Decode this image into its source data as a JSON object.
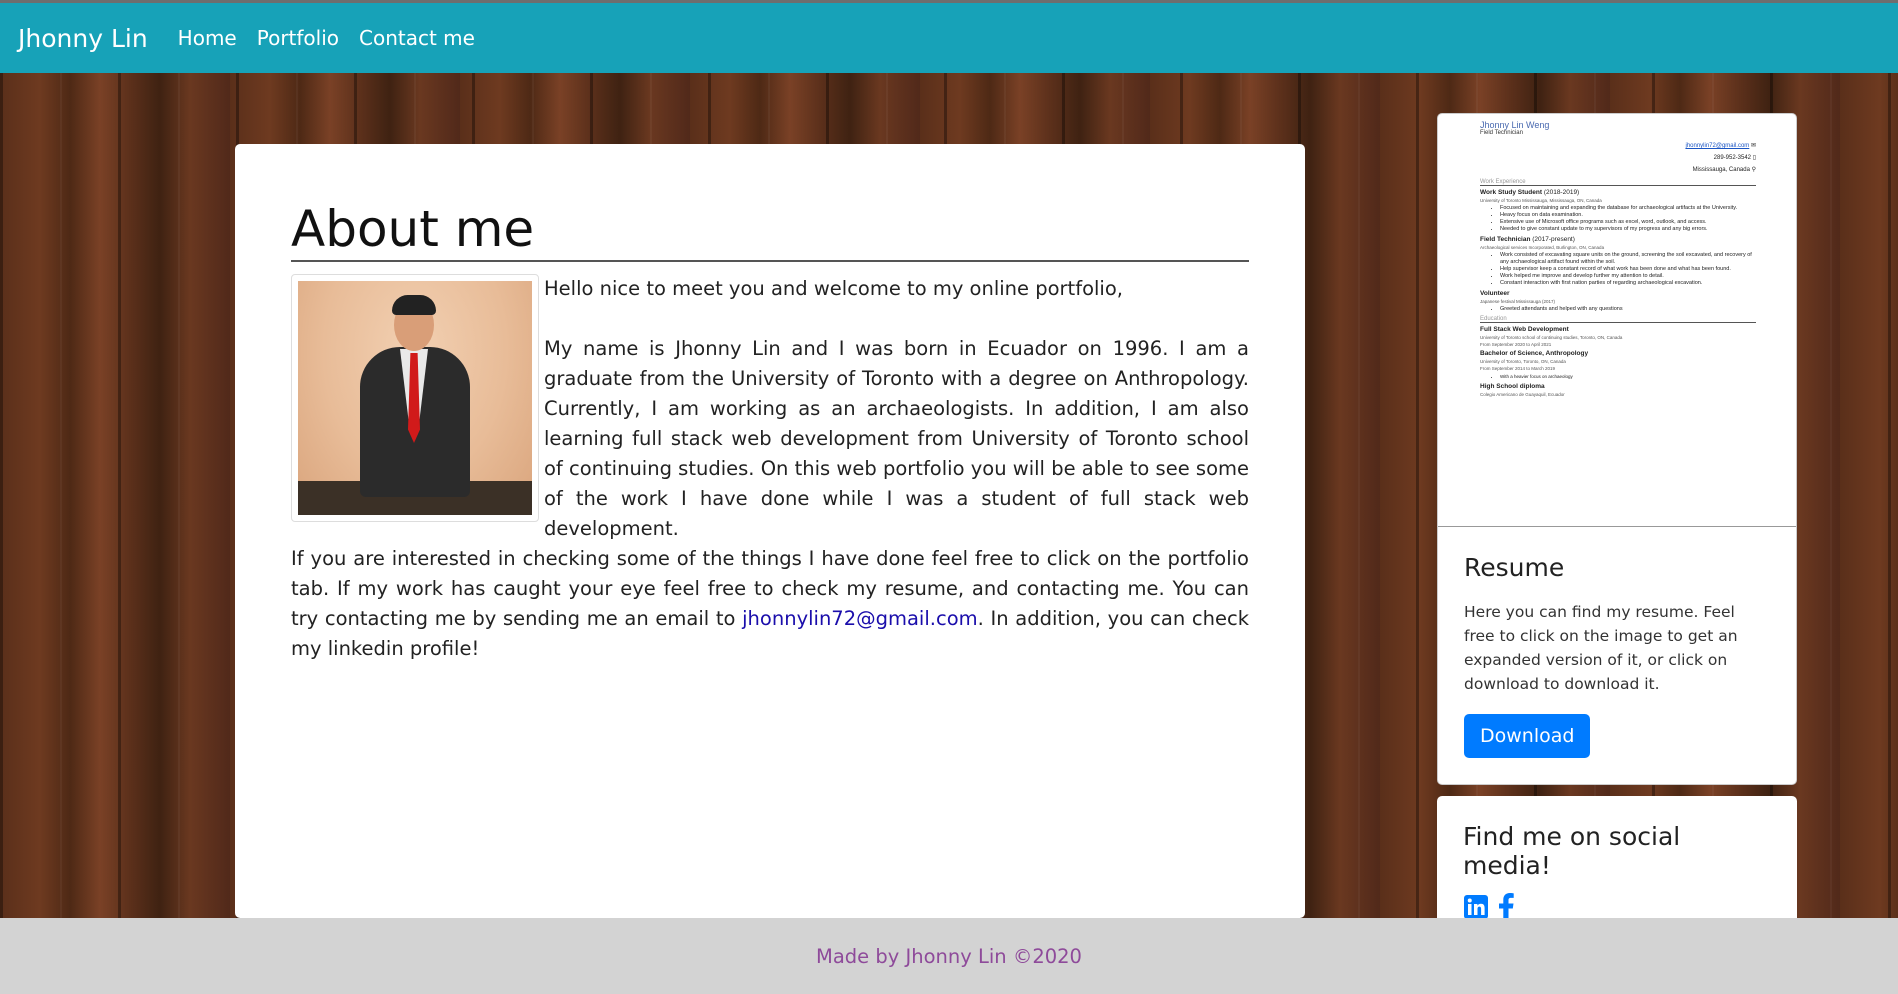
{
  "nav": {
    "brand": "Jhonny Lin",
    "links": [
      "Home",
      "Portfolio",
      "Contact me"
    ]
  },
  "about": {
    "title": "About me",
    "greeting": "Hello nice to meet you and welcome to my online portfolio,",
    "paragraph1": "My name is Jhonny Lin and I was born in Ecuador on 1996. I am a graduate from the University of Toronto with a degree on Anthropology. Currently, I am working as an archaeologists. In addition, I am also learning full stack web development from University of Toronto school of continuing studies. On this web portfolio you will be able to see some of the work I have done while I was a student of full stack web development.",
    "paragraph2_before": "If you are interested in checking some of the things I have done feel free to click on the portfolio tab. If my work has caught your eye feel free to check my resume, and contacting me. You can try contacting me by sending me an email to ",
    "email": "jhonnylin72@gmail.com",
    "paragraph2_after": ". In addition, you can check my linkedin profile!"
  },
  "resume_preview": {
    "name": "Jhonny Lin Weng",
    "role": "Field Technician",
    "email": "jhonnylin72@gmail.com",
    "phone": "289-952-3542",
    "location": "Mississauga, Canada",
    "work_heading": "Work Experience",
    "jobs": [
      {
        "title": "Work Study Student",
        "dates": "(2018-2019)",
        "org": "University of Toronto Mississauga, Mississauga, ON, Canada",
        "bullets": [
          "Focused on maintaining and expanding the database for archaeological artifacts at the University.",
          "Heavy focus on data examination.",
          "Extensive use of Microsoft office programs such as excel, word, outlook, and access.",
          "Needed to give constant update to my supervisors of my progress and any big errors."
        ]
      },
      {
        "title": "Field Technician",
        "dates": "(2017-present)",
        "org": "Archaeological services Incorporated, Burlington, ON, Canada",
        "bullets": [
          "Work consisted of excavating square units on the ground, screening the soil excavated, and recovery of any archaeological artifact found within the soil.",
          "Help supervisor keep a constant record of what work has been done and what has been found.",
          "Work helped me improve and develop further my attention to detail.",
          "Constant interaction with first nation parties of regarding archaeological excavation."
        ]
      },
      {
        "title": "Volunteer",
        "dates": "",
        "org": "Japanese festival Mississauga (2017)",
        "bullets": [
          "Greeted attendants and helped with any questions"
        ]
      }
    ],
    "education_heading": "Education",
    "education": [
      {
        "title": "Full Stack Web Development",
        "org": "University of Toronto school of continuing studies, Toronto, ON, Canada",
        "dates": "From September 2020 to April 2021"
      },
      {
        "title": "Bachelor of Science, Anthropology",
        "org": "University of Toronto, Toronto, ON, Canada",
        "dates": "From September 2014 to March 2019",
        "note": "With a heavier focus on archaeology"
      },
      {
        "title": "High School diploma",
        "org": "Colegio Americano de Guayaquil, Ecuador",
        "dates": ""
      }
    ]
  },
  "resume_card": {
    "title": "Resume",
    "text": "Here you can find my resume. Feel free to click on the image to get an expanded version of it, or click on download to download it.",
    "button": "Download"
  },
  "social_card": {
    "title": "Find me on social media!",
    "icons": [
      "linkedin-icon",
      "facebook-icon"
    ]
  },
  "footer": {
    "text": "Made by Jhonny Lin ©2020"
  },
  "colors": {
    "navbar": "#17a2b8",
    "button": "#007bff",
    "footer_bg": "#d3d3d3",
    "footer_text": "#8e4a9a",
    "link": "#1a0dab"
  }
}
